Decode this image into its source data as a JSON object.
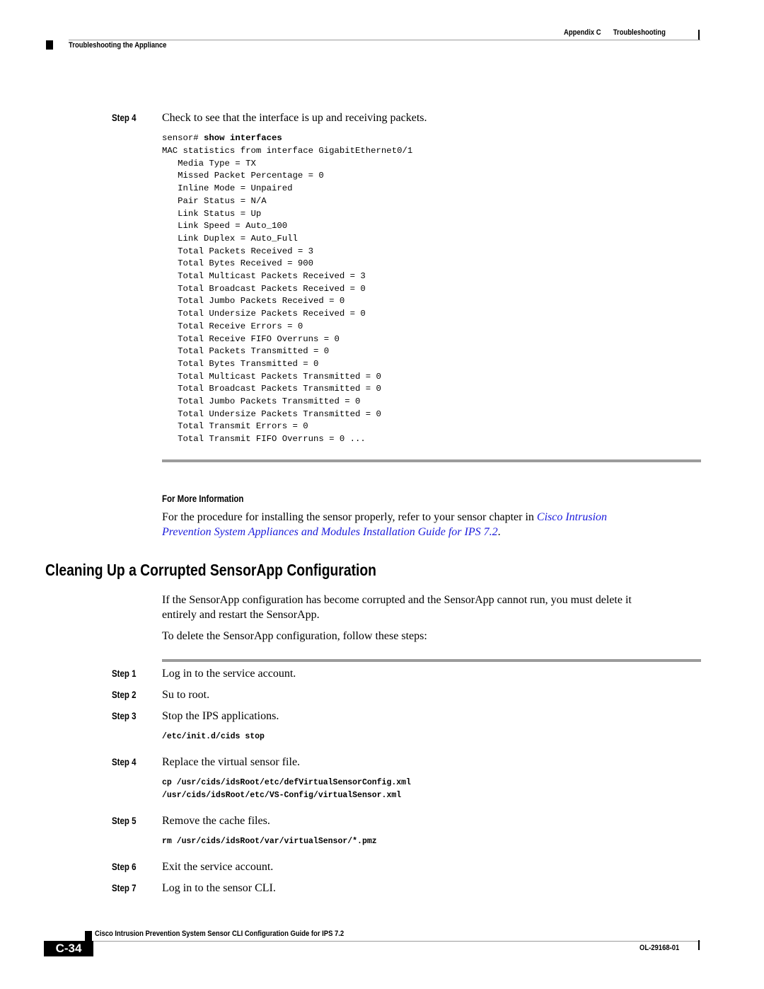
{
  "header": {
    "chapter": "Appendix C",
    "chapter_title": "Troubleshooting",
    "section": "Troubleshooting the Appliance"
  },
  "step4_check": {
    "label": "Step 4",
    "text": "Check to see that the interface is up and receiving packets.",
    "prompt": "sensor# ",
    "command": "show interfaces",
    "output_lines": [
      "MAC statistics from interface GigabitEthernet0/1",
      "   Media Type = TX",
      "   Missed Packet Percentage = 0",
      "   Inline Mode = Unpaired",
      "   Pair Status = N/A",
      "   Link Status = Up",
      "   Link Speed = Auto_100",
      "   Link Duplex = Auto_Full",
      "   Total Packets Received = 3",
      "   Total Bytes Received = 900",
      "   Total Multicast Packets Received = 3",
      "   Total Broadcast Packets Received = 0",
      "   Total Jumbo Packets Received = 0",
      "   Total Undersize Packets Received = 0",
      "   Total Receive Errors = 0",
      "   Total Receive FIFO Overruns = 0",
      "   Total Packets Transmitted = 0",
      "   Total Bytes Transmitted = 0",
      "   Total Multicast Packets Transmitted = 0",
      "   Total Broadcast Packets Transmitted = 0",
      "   Total Jumbo Packets Transmitted = 0",
      "   Total Undersize Packets Transmitted = 0",
      "   Total Transmit Errors = 0",
      "   Total Transmit FIFO Overruns = 0 ..."
    ]
  },
  "more_info": {
    "heading": "For More Information",
    "text_before": "For the procedure for installing the sensor properly, refer to your sensor chapter in ",
    "link_line1": "Cisco Intrusion",
    "link_line2": "Prevention System Appliances and Modules Installation Guide for IPS 7.2",
    "text_after": "."
  },
  "section": {
    "title": "Cleaning Up a Corrupted SensorApp Configuration",
    "intro_line1": "If the SensorApp configuration has become corrupted and the SensorApp cannot run, you must delete it",
    "intro_line2": "entirely and restart the SensorApp.",
    "lead": "To delete the SensorApp configuration, follow these steps:",
    "steps": [
      {
        "label": "Step 1",
        "text": "Log in to the service account."
      },
      {
        "label": "Step 2",
        "text": "Su to root."
      },
      {
        "label": "Step 3",
        "text": "Stop the IPS applications.",
        "code": [
          "/etc/init.d/cids stop"
        ]
      },
      {
        "label": "Step 4",
        "text": "Replace the virtual sensor file.",
        "code": [
          "cp /usr/cids/idsRoot/etc/defVirtualSensorConfig.xml",
          "/usr/cids/idsRoot/etc/VS-Config/virtualSensor.xml"
        ]
      },
      {
        "label": "Step 5",
        "text": "Remove the cache files.",
        "code": [
          "rm /usr/cids/idsRoot/var/virtualSensor/*.pmz"
        ]
      },
      {
        "label": "Step 6",
        "text": "Exit the service account."
      },
      {
        "label": "Step 7",
        "text": "Log in to the sensor CLI."
      }
    ]
  },
  "footer": {
    "book_title": "Cisco Intrusion Prevention System Sensor CLI Configuration Guide for IPS 7.2",
    "page_number": "C-34",
    "doc_id": "OL-29168-01"
  },
  "colors": {
    "link": "#1a1adb",
    "rule": "#9b9b9b"
  }
}
